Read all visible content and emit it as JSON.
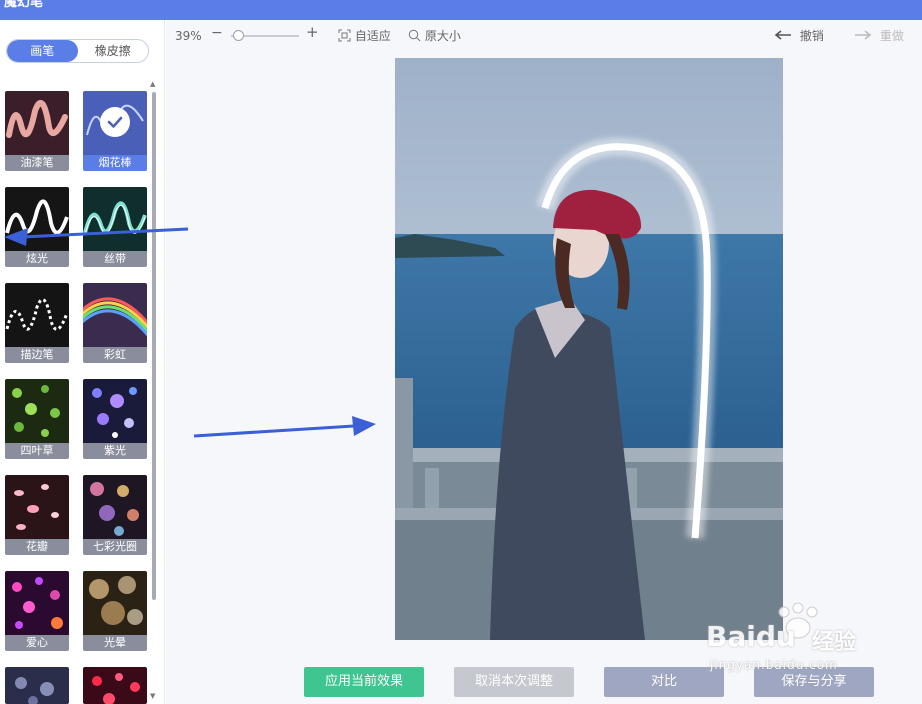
{
  "app": {
    "title": "魔幻笔"
  },
  "mode_tabs": [
    {
      "label": "画笔",
      "active": true
    },
    {
      "label": "橡皮擦",
      "active": false
    }
  ],
  "brushes": [
    {
      "label": "油漆笔",
      "icon": "oil-paint-brush-icon",
      "selected": false
    },
    {
      "label": "烟花棒",
      "icon": "sparkler-brush-icon",
      "selected": true
    },
    {
      "label": "炫光",
      "icon": "glow-brush-icon",
      "selected": false
    },
    {
      "label": "丝带",
      "icon": "ribbon-brush-icon",
      "selected": false
    },
    {
      "label": "描边笔",
      "icon": "outline-brush-icon",
      "selected": false
    },
    {
      "label": "彩虹",
      "icon": "rainbow-brush-icon",
      "selected": false
    },
    {
      "label": "四叶草",
      "icon": "clover-brush-icon",
      "selected": false
    },
    {
      "label": "紫光",
      "icon": "purple-light-brush-icon",
      "selected": false
    },
    {
      "label": "花瓣",
      "icon": "petal-brush-icon",
      "selected": false
    },
    {
      "label": "七彩光圈",
      "icon": "rainbow-bokeh-brush-icon",
      "selected": false
    },
    {
      "label": "爱心",
      "icon": "heart-brush-icon",
      "selected": false
    },
    {
      "label": "光晕",
      "icon": "halo-brush-icon",
      "selected": false
    },
    {
      "label": "",
      "icon": "bokeh-brush-icon",
      "selected": false
    },
    {
      "label": "",
      "icon": "red-heart-brush-icon",
      "selected": false
    }
  ],
  "toolbar": {
    "zoom": "39%",
    "zoom_level_fraction": 0.1,
    "fit_label": "自适应",
    "original_label": "原大小",
    "undo_label": "撤销",
    "redo_label": "重做"
  },
  "actions": {
    "apply": "应用当前效果",
    "cancel": "取消本次调整",
    "compare": "对比",
    "save_share": "保存与分享"
  },
  "watermark": {
    "brand": "Baidu",
    "cn": "经验",
    "url": "jingyan.baidu.com"
  },
  "colors": {
    "accent": "#5b7ee6",
    "apply": "#3ec590",
    "cancel": "#c6c8cf",
    "compare": "#9fa6c1",
    "annotation_arrow": "#3a5fd6"
  }
}
